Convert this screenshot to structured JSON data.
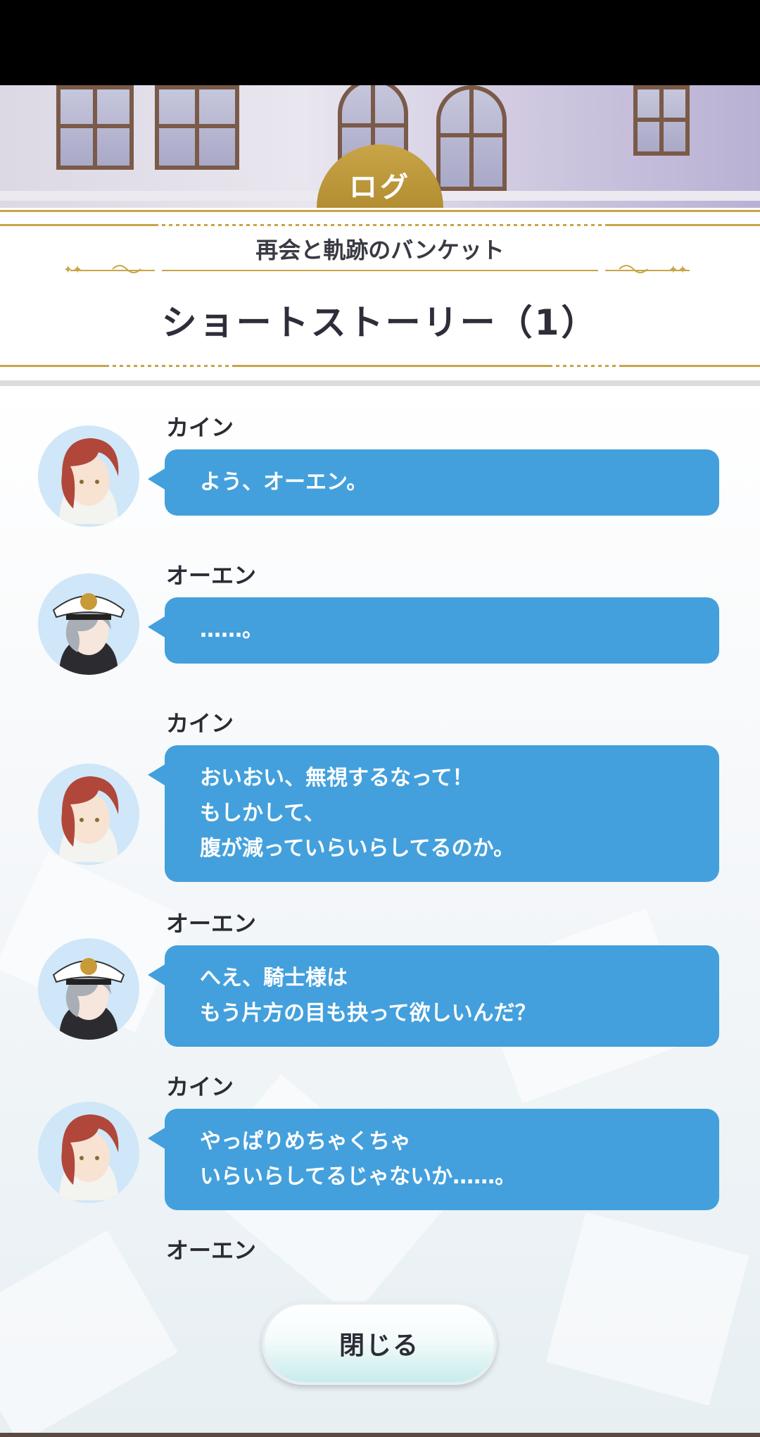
{
  "header": {
    "tab_label": "ログ"
  },
  "story": {
    "event_title": "再会と軌跡のバンケット",
    "title": "ショートストーリー（1）"
  },
  "log": [
    {
      "speaker": "カイン",
      "avatar": "kain-avatar",
      "lines": [
        "よう、オーエン。"
      ]
    },
    {
      "speaker": "オーエン",
      "avatar": "owen-avatar",
      "lines": [
        "……。"
      ]
    },
    {
      "speaker": "カイン",
      "avatar": "kain-avatar",
      "lines": [
        "おいおい、無視するなって！",
        "もしかして、",
        "腹が減っていらいらしてるのか。"
      ]
    },
    {
      "speaker": "オーエン",
      "avatar": "owen-avatar",
      "lines": [
        "へえ、騎士様は",
        "もう片方の目も抉って欲しいんだ？"
      ]
    },
    {
      "speaker": "カイン",
      "avatar": "kain-avatar",
      "lines": [
        "やっぱりめちゃくちゃ",
        "いらいらしてるじゃないか……。"
      ]
    },
    {
      "speaker": "オーエン"
    }
  ],
  "close_button": {
    "label": "閉じる"
  },
  "colors": {
    "bubble": "#43a0dc",
    "gold": "#c9a548"
  }
}
